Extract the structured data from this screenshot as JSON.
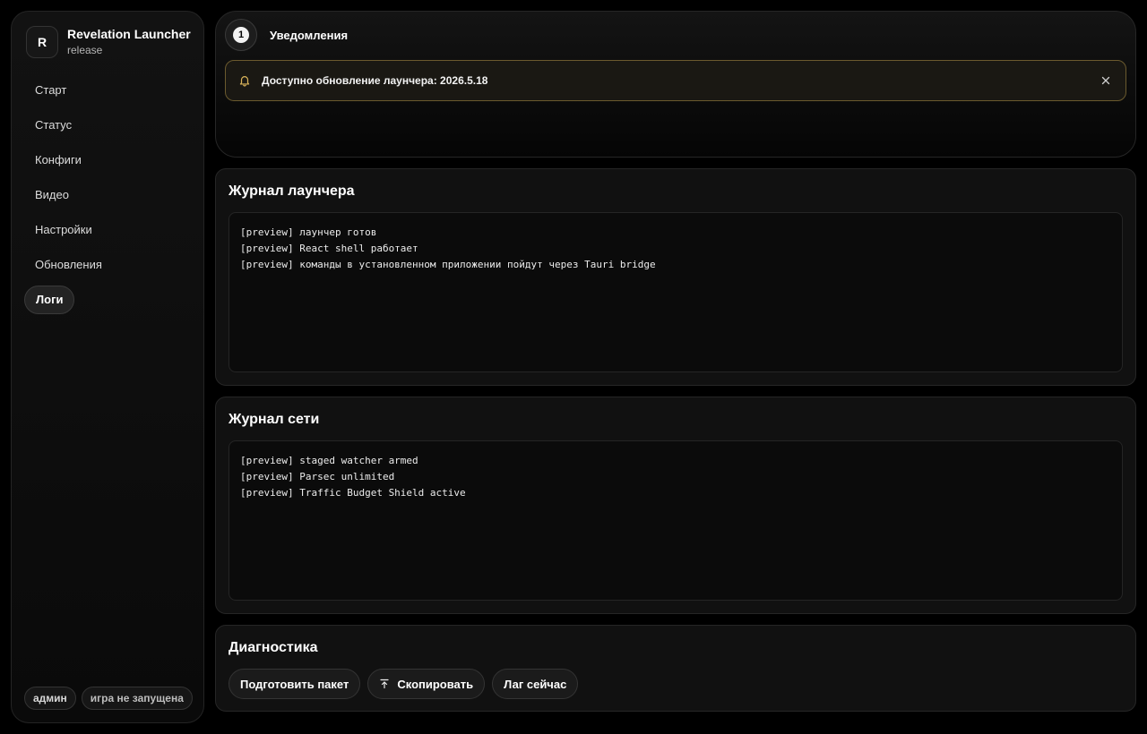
{
  "brand": {
    "logo_letter": "R",
    "title": "Revelation Launcher",
    "subtitle": "release"
  },
  "nav": {
    "items": [
      {
        "label": "Старт",
        "active": false
      },
      {
        "label": "Статус",
        "active": false
      },
      {
        "label": "Конфиги",
        "active": false
      },
      {
        "label": "Видео",
        "active": false
      },
      {
        "label": "Настройки",
        "active": false
      },
      {
        "label": "Обновления",
        "active": false
      },
      {
        "label": "Логи",
        "active": true
      }
    ]
  },
  "footer": {
    "role_chip": "админ",
    "game_status_chip": "игра не запущена"
  },
  "notifications": {
    "title": "Уведомления",
    "count": "1",
    "alert_text": "Доступно обновление лаунчера: 2026.5.18",
    "alert_icon": "bell-icon",
    "close_icon": "close-icon"
  },
  "launcher_log": {
    "title": "Журнал лаунчера",
    "lines": [
      "[preview] лаунчер готов",
      "[preview] React shell работает",
      "[preview] команды в установленном приложении пойдут через Tauri bridge"
    ]
  },
  "network_log": {
    "title": "Журнал сети",
    "lines": [
      "[preview] staged watcher armed",
      "[preview] Parsec unlimited",
      "[preview] Traffic Budget Shield active"
    ]
  },
  "diagnostics": {
    "title": "Диагностика",
    "prepare_label": "Подготовить пакет",
    "copy_label": "Скопировать",
    "lag_label": "Лаг сейчас"
  },
  "colors": {
    "background": "#000000",
    "alert_border": "#6b5a2e",
    "bell": "#d9b35a"
  }
}
